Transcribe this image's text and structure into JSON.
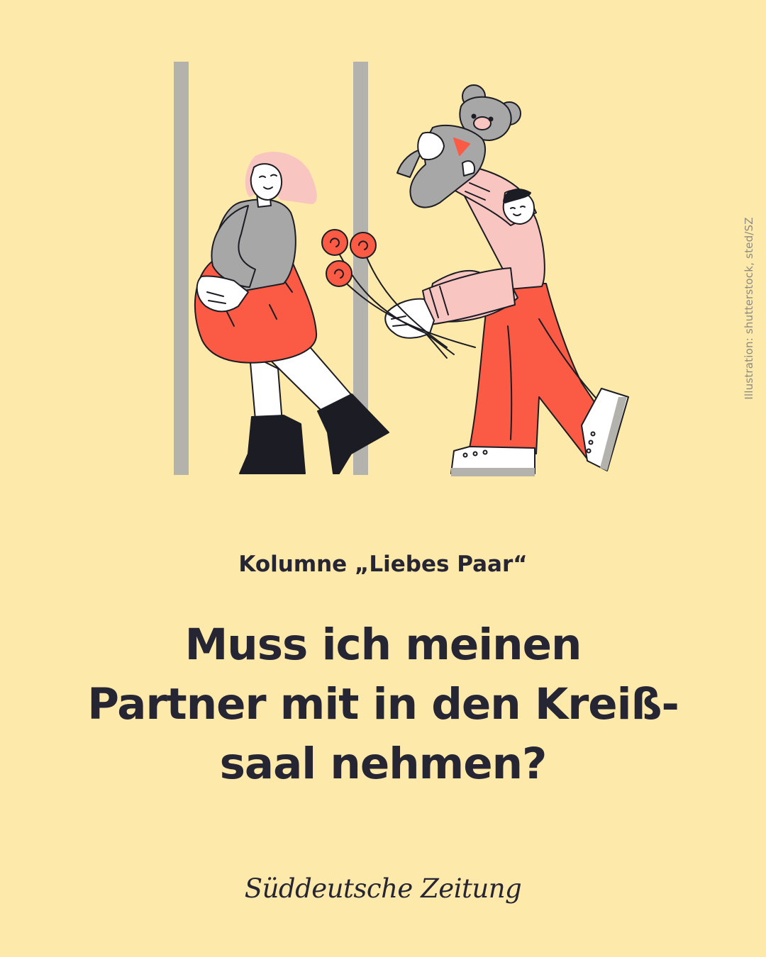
{
  "colors": {
    "background": "#fde9a9",
    "text": "#262533",
    "accent_red": "#fb5b45",
    "pink": "#f8c5c0",
    "grey": "#a5a5a5"
  },
  "credit": "Illustration: shutterstock, sted/SZ",
  "kicker": "Kolumne „Liebes Paar“",
  "headline": {
    "line1": "Muss ich meinen",
    "line2": "Partner mit in den Kreiß-",
    "line3": "saal nehmen?"
  },
  "brand": {
    "logo": "Süddeutsche Zeitung"
  },
  "illustration": {
    "description_icons": [
      "doorframe-icon",
      "woman-figure-icon",
      "man-figure-icon",
      "teddy-bear-icon",
      "roses-bouquet-icon"
    ]
  }
}
